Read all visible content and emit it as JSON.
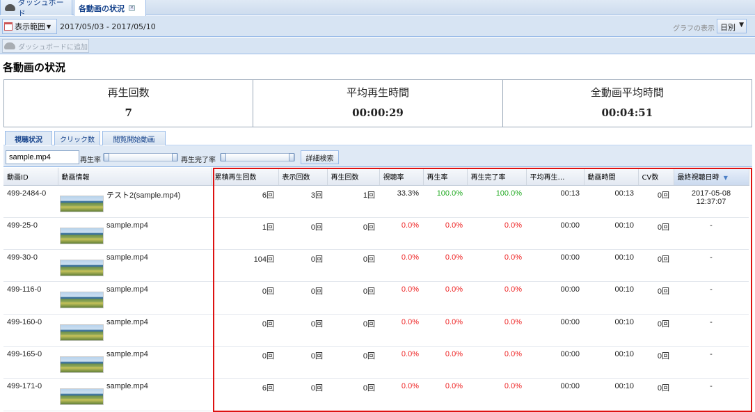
{
  "tabs": [
    {
      "label": "ダッシュボード",
      "icon": "dashboard-icon"
    },
    {
      "label": "各動画の状況",
      "icon": "close-icon"
    }
  ],
  "toolbar": {
    "range_label": "表示範囲",
    "date_range": "2017/05/03 - 2017/05/10",
    "graph_label": "グラフの表示",
    "graph_value": "日別",
    "add_dashboard": "ダッシュボードに追加"
  },
  "page_title": "各動画の状況",
  "summary": [
    {
      "label": "再生回数",
      "value": "7"
    },
    {
      "label": "平均再生時間",
      "value": "00:00:29"
    },
    {
      "label": "全動画平均時間",
      "value": "00:04:51"
    }
  ],
  "subtabs": [
    "視聴状況",
    "クリック数",
    "閲覧開始動画"
  ],
  "filter": {
    "search_value": "sample.mp4",
    "play_rate_label": "再生率",
    "completion_rate_label": "再生完了率",
    "advanced_button": "詳細検索"
  },
  "columns": [
    "動画ID",
    "動画情報",
    "累積再生回数",
    "表示回数",
    "再生回数",
    "視聴率",
    "再生率",
    "再生完了率",
    "平均再生…",
    "動画時間",
    "CV数",
    "最終視聴日時"
  ],
  "rows": [
    {
      "id": "499-2484-0",
      "name": "テスト2(sample.mp4)",
      "cum": "6回",
      "views": "3回",
      "plays": "1回",
      "watch": "33.3%",
      "play_rate": "100.0%",
      "complete": "100.0%",
      "avg": "00:13",
      "duration": "00:13",
      "cv": "0回",
      "last_date": "2017-05-08",
      "last_time": "12:37:07"
    },
    {
      "id": "499-25-0",
      "name": "sample.mp4",
      "cum": "1回",
      "views": "0回",
      "plays": "0回",
      "watch": "0.0%",
      "play_rate": "0.0%",
      "complete": "0.0%",
      "avg": "00:00",
      "duration": "00:10",
      "cv": "0回",
      "last_date": "-",
      "last_time": ""
    },
    {
      "id": "499-30-0",
      "name": "sample.mp4",
      "cum": "104回",
      "views": "0回",
      "plays": "0回",
      "watch": "0.0%",
      "play_rate": "0.0%",
      "complete": "0.0%",
      "avg": "00:00",
      "duration": "00:10",
      "cv": "0回",
      "last_date": "-",
      "last_time": ""
    },
    {
      "id": "499-116-0",
      "name": "sample.mp4",
      "cum": "0回",
      "views": "0回",
      "plays": "0回",
      "watch": "0.0%",
      "play_rate": "0.0%",
      "complete": "0.0%",
      "avg": "00:00",
      "duration": "00:10",
      "cv": "0回",
      "last_date": "-",
      "last_time": ""
    },
    {
      "id": "499-160-0",
      "name": "sample.mp4",
      "cum": "0回",
      "views": "0回",
      "plays": "0回",
      "watch": "0.0%",
      "play_rate": "0.0%",
      "complete": "0.0%",
      "avg": "00:00",
      "duration": "00:10",
      "cv": "0回",
      "last_date": "-",
      "last_time": ""
    },
    {
      "id": "499-165-0",
      "name": "sample.mp4",
      "cum": "0回",
      "views": "0回",
      "plays": "0回",
      "watch": "0.0%",
      "play_rate": "0.0%",
      "complete": "0.0%",
      "avg": "00:00",
      "duration": "00:10",
      "cv": "0回",
      "last_date": "-",
      "last_time": ""
    },
    {
      "id": "499-171-0",
      "name": "sample.mp4",
      "cum": "6回",
      "views": "0回",
      "plays": "0回",
      "watch": "0.0%",
      "play_rate": "0.0%",
      "complete": "0.0%",
      "avg": "00:00",
      "duration": "00:10",
      "cv": "0回",
      "last_date": "-",
      "last_time": ""
    }
  ],
  "colors": {
    "accent": "#15428b",
    "positive": "#22aa22",
    "zero": "#ee2222",
    "highlight": "#dd1111"
  }
}
